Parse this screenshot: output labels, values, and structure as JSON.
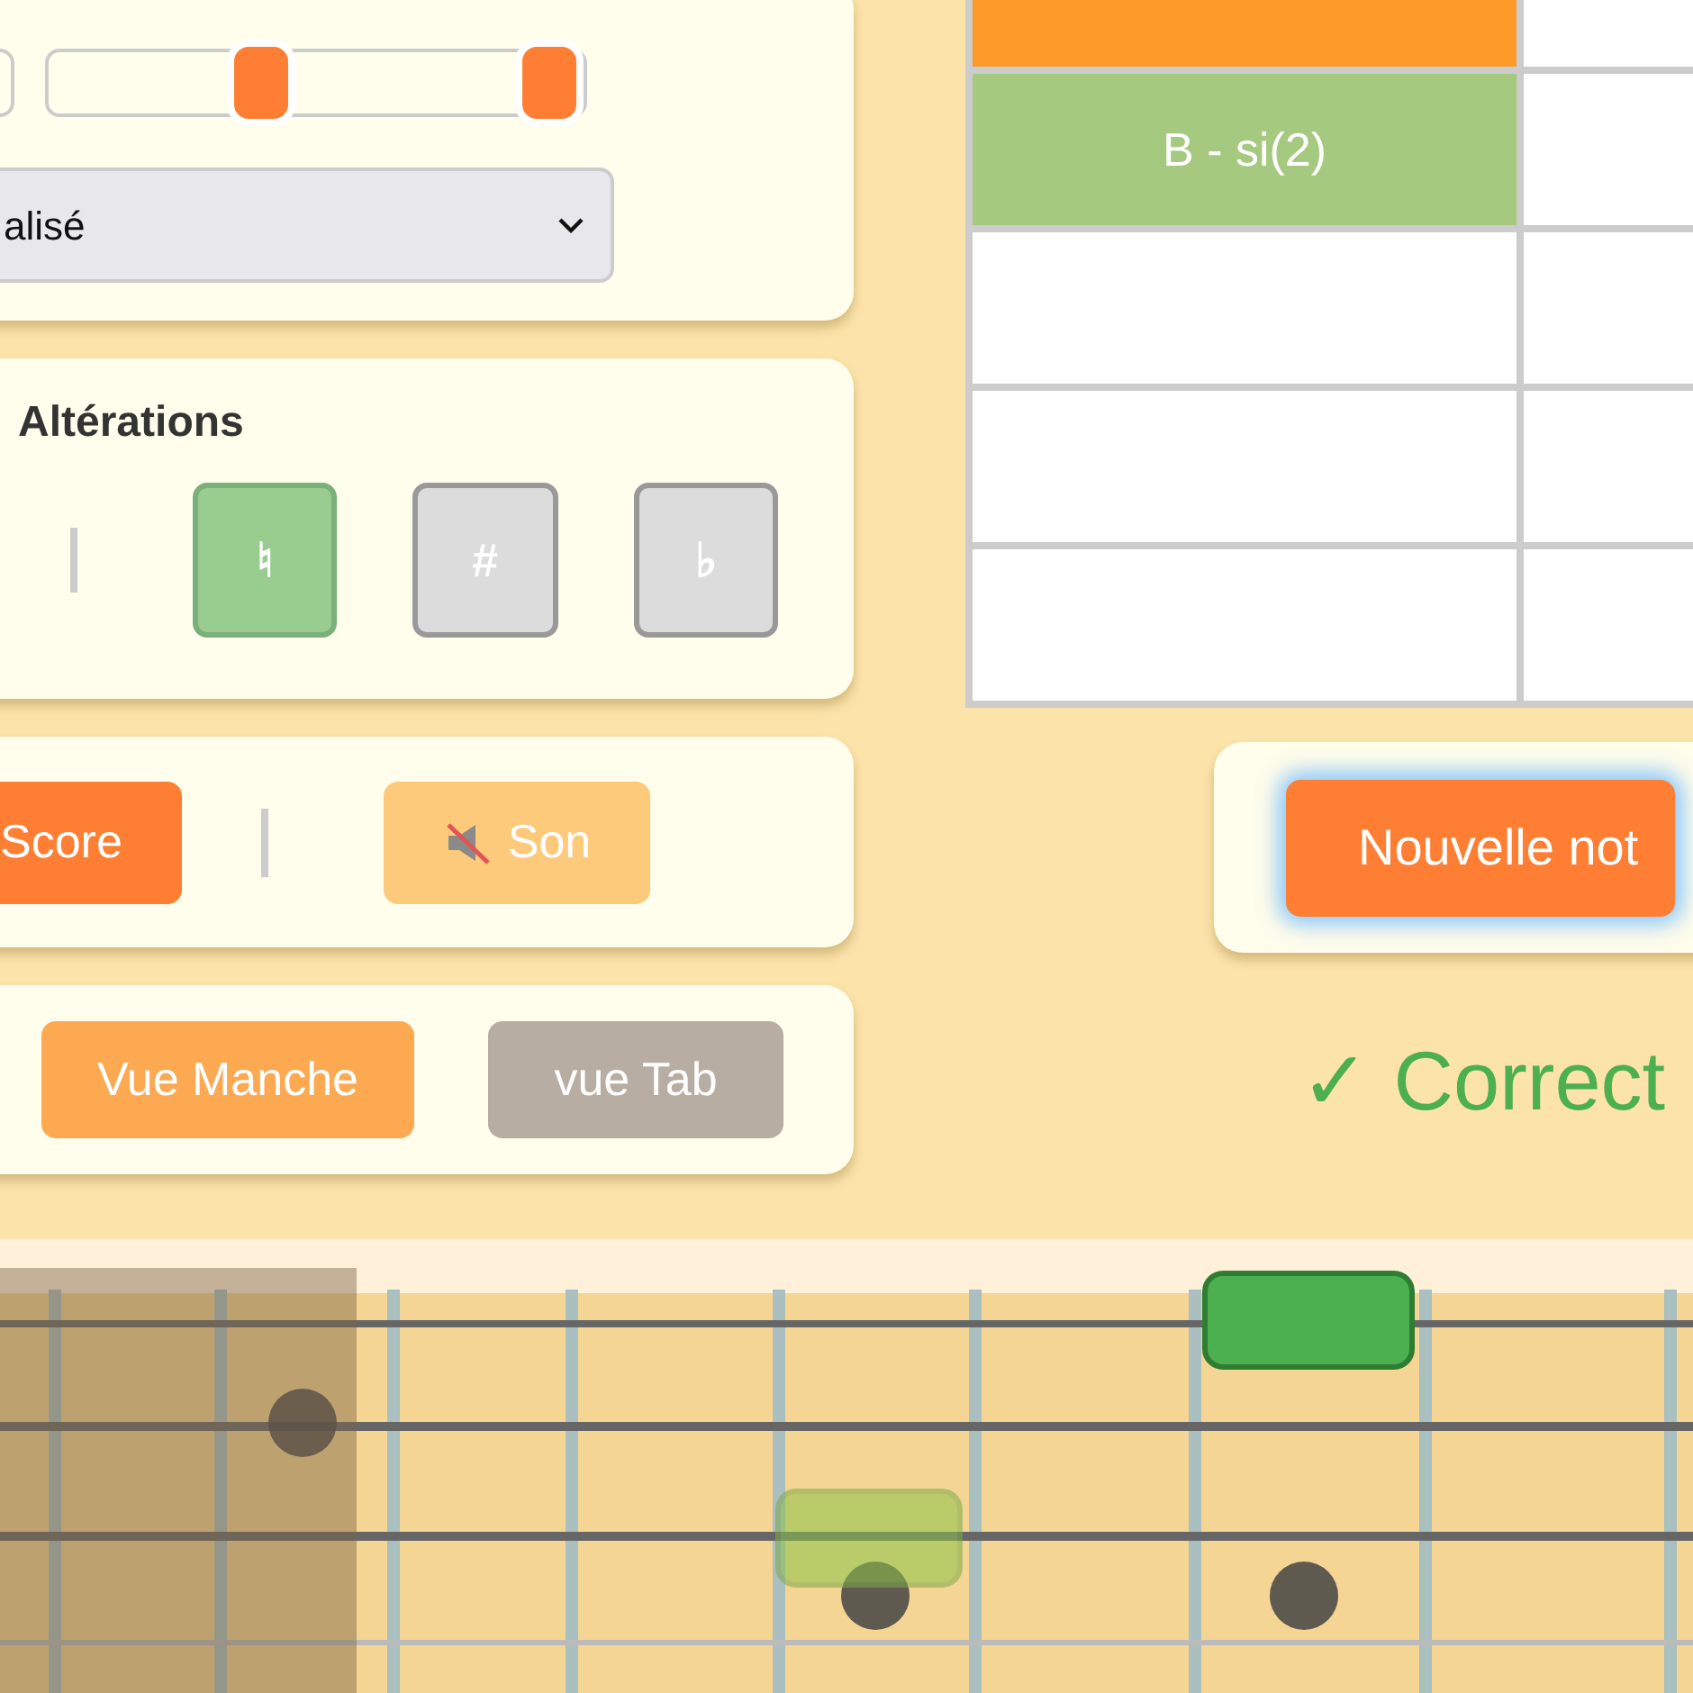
{
  "range_card": {
    "thumbs": [
      {
        "level": 0.4
      },
      {
        "level": 0.93
      }
    ],
    "select": {
      "value": "alisé"
    }
  },
  "alterations": {
    "title": "Altérations",
    "options": [
      {
        "symbol": "♮",
        "selected": true
      },
      {
        "symbol": "#",
        "selected": false
      },
      {
        "symbol": "♭",
        "selected": false
      }
    ]
  },
  "controls": {
    "score_button": "Score",
    "sound_button": {
      "label": "Son",
      "muted": true
    }
  },
  "views": [
    {
      "label": "Vue Manche",
      "selected": true
    },
    {
      "label": "vue Tab",
      "selected": false
    }
  ],
  "table": {
    "rows": [
      {
        "kind": "note",
        "color": "#fe9a2a"
      },
      {
        "kind": "note",
        "color": "#a6c980",
        "note": "B - si(2)"
      },
      {
        "kind": "blank"
      },
      {
        "kind": "blank"
      },
      {
        "kind": "blank"
      }
    ]
  },
  "new_note_button": "Nouvelle not",
  "feedback": {
    "kind": "correct",
    "text": "✓ Correct"
  },
  "fretboard": {
    "markers": [
      {
        "kind": "correct"
      },
      {
        "kind": "hint"
      }
    ]
  }
}
